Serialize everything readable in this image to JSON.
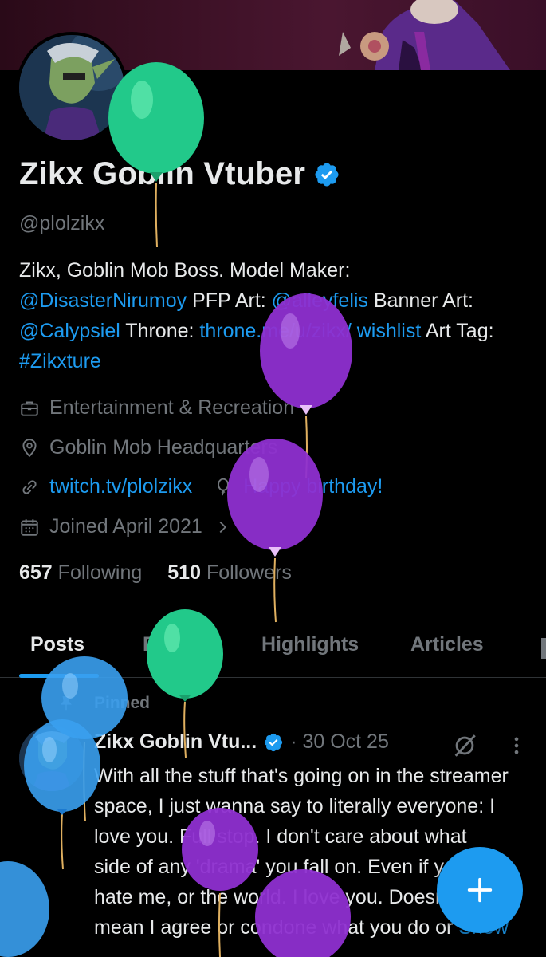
{
  "profile": {
    "display_name": "Zikx Goblin Vtuber",
    "handle": "@plolzikx",
    "bio": {
      "t1": "Zikx, Goblin Mob Boss. Model Maker:",
      "m1": "@DisasterNirumoy",
      "t2": " PFP Art: ",
      "m2": "@alleyfelis",
      "t3": " Banner Art: ",
      "m3": "@Calypsiel",
      "t4": " Throne: ",
      "u1": "throne.me/u/zikx/ wishlist",
      "t5": " Art Tag: ",
      "h1": "#Zikxture"
    },
    "category": "Entertainment & Recreation",
    "location": "Goblin Mob Headquarters",
    "website": "twitch.tv/plolzikx",
    "birthday": "Happy birthday!",
    "joined": "Joined April 2021",
    "following_count": "657",
    "following_label": "Following",
    "followers_count": "510",
    "followers_label": "Followers"
  },
  "tabs": [
    "Posts",
    "Replies",
    "Highlights",
    "Articles"
  ],
  "post": {
    "pinned_label": "Pinned",
    "author": "Zikx Goblin Vtu...",
    "date": "· 30 Oct 25",
    "text": "With all the stuff that's going on in the streamer space, I just wanna say to literally everyone: I love you. Full stop. I don't care about what side of any 'drama' you fall on. Even if you hate me, or the world. I love you. Doesn't mean I agree or condone what you do or ",
    "show_more": "Show"
  },
  "icons": {
    "verified": "verified-badge-icon",
    "category": "briefcase-icon",
    "location": "location-pin-icon",
    "website": "link-icon",
    "birthday": "balloon-icon",
    "joined": "calendar-icon",
    "pin": "pin-icon",
    "grok": "grok-icon",
    "more": "more-vertical-icon",
    "compose": "plus-icon"
  },
  "colors": {
    "accent": "#1d9bf0",
    "text": "#e7e9ea",
    "secondary": "#71767b",
    "background": "#000000"
  }
}
